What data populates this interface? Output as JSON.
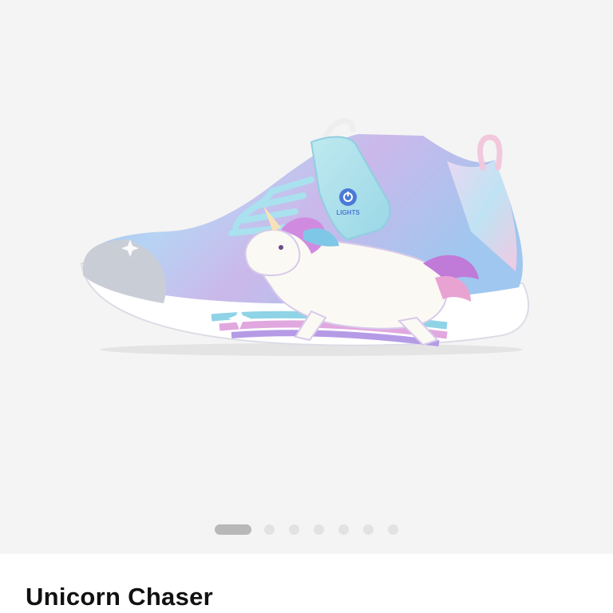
{
  "product": {
    "name": "Unicorn Chaser",
    "image_alt": "Unicorn Chaser light-up sneaker, side view",
    "badge_text": "LIGHTS"
  },
  "gallery": {
    "total_images": 7,
    "active_index": 0
  },
  "colors": {
    "gallery_background": "#f4f4f4",
    "active_dot": "#b8b8b8",
    "inactive_dot": "#e2e2e2"
  }
}
